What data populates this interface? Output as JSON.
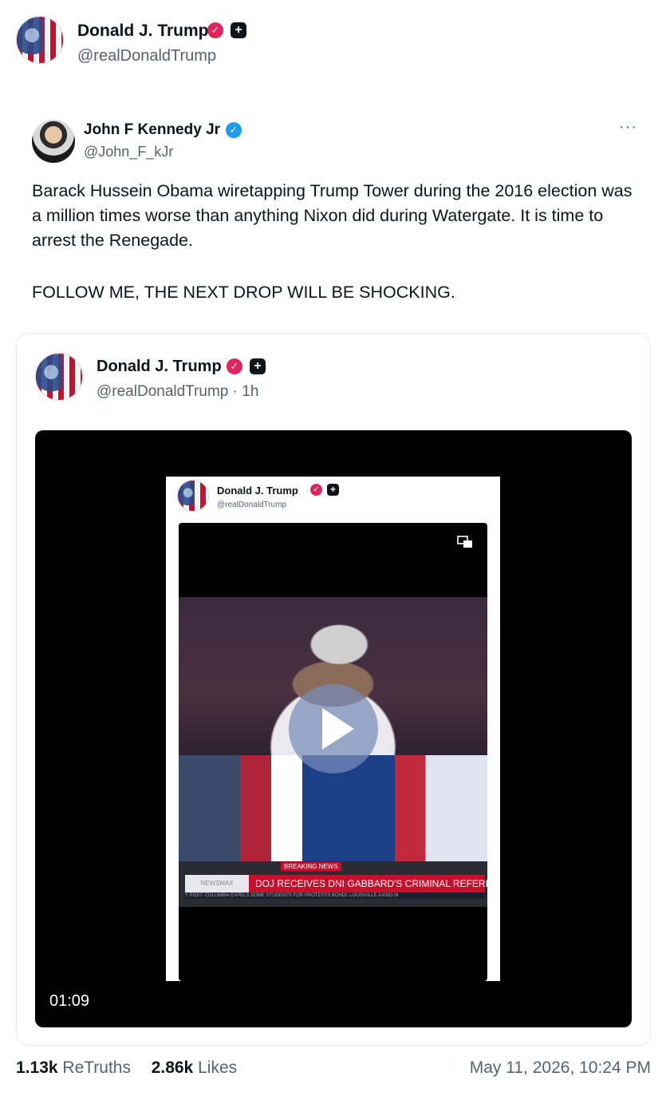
{
  "post": {
    "author": {
      "name": "Donald J. Trump",
      "handle": "@realDonaldTrump"
    },
    "retruths_count": "1.13k",
    "retruths_label": "ReTruths",
    "likes_count": "2.86k",
    "likes_label": "Likes",
    "timestamp": "May 11, 2026, 10:24 PM"
  },
  "reposted": {
    "author": {
      "name": "John F Kennedy Jr",
      "handle": "@John_F_kJr"
    },
    "more_label": "···",
    "paragraphs": [
      "Barack Hussein Obama wiretapping Trump Tower during the 2016 election was a million times worse than anything Nixon did during Watergate. It is time to arrest the Renegade.",
      "FOLLOW ME, THE NEXT DROP WILL BE SHOCKING."
    ]
  },
  "quote": {
    "author": {
      "name": "Donald J. Trump",
      "handle": "@realDonaldTrump · 1h"
    },
    "video": {
      "duration": "01:09",
      "inner_author_name": "Donald J. Trump",
      "inner_author_handle": "@realDonaldTrump",
      "breaking_label": "BREAKING NEWS",
      "network": "NEWSMAX",
      "headline": "DOJ RECEIVES DNI GABBARD'S CRIMINAL REFERRAL",
      "ticker": "Y POST: COLUMBIA EXPELS SOME STUDENTS FOR PROTESTS    BONDI: LOUISVILLE AXING M"
    }
  },
  "badges": {
    "verified_pink": "#e0245e",
    "verified_blue": "#1d9bf0",
    "plus_symbol": "+",
    "check_symbol": "✓"
  },
  "icons": [
    "verified-badge-icon",
    "plus-badge-icon",
    "more-icon",
    "fullscreen-icon",
    "play-icon"
  ]
}
